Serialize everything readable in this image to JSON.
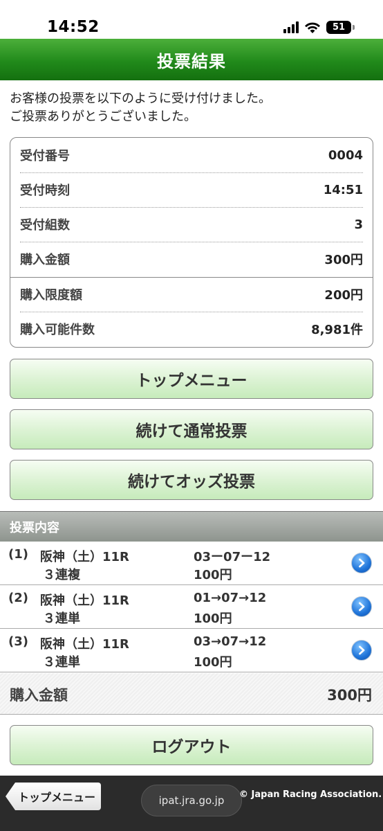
{
  "status_bar": {
    "time": "14:52",
    "battery": "51"
  },
  "header": {
    "title": "投票結果"
  },
  "intro": {
    "line1": "お客様の投票を以下のように受け付けました。",
    "line2": "ご投票ありがとうございました。"
  },
  "summary": [
    {
      "label": "受付番号",
      "value": "0004"
    },
    {
      "label": "受付時刻",
      "value": "14:51"
    },
    {
      "label": "受付組数",
      "value": "3"
    },
    {
      "label": "購入金額",
      "value": "300円"
    },
    {
      "label": "購入限度額",
      "value": "200円"
    },
    {
      "label": "購入可能件数",
      "value": "8,981件"
    }
  ],
  "buttons": {
    "top_menu": "トップメニュー",
    "continue_normal": "続けて通常投票",
    "continue_odds": "続けてオッズ投票",
    "logout": "ログアウト"
  },
  "bets_section": {
    "title": "投票内容",
    "items": [
      {
        "num": "(1)",
        "race": "阪神（土）11R",
        "type": "３連複",
        "combo": "03ー07ー12",
        "amount": "100円"
      },
      {
        "num": "(2)",
        "race": "阪神（土）11R",
        "type": "３連単",
        "combo": "01→07→12",
        "amount": "100円"
      },
      {
        "num": "(3)",
        "race": "阪神（土）11R",
        "type": "３連単",
        "combo": "03→07→12",
        "amount": "100円"
      }
    ]
  },
  "total": {
    "label": "購入金額",
    "value": "300円"
  },
  "footer": {
    "top_menu": "トップメニュー",
    "url": "ipat.jra.go.jp",
    "copyright": "© Japan Racing Association."
  },
  "colors": {
    "header_green": "#218a1b",
    "button_green": "#ddf3d5",
    "chevron_blue": "#1f74d9"
  },
  "icons": [
    "signal-icon",
    "wifi-icon",
    "battery-icon",
    "chevron-right-icon"
  ]
}
